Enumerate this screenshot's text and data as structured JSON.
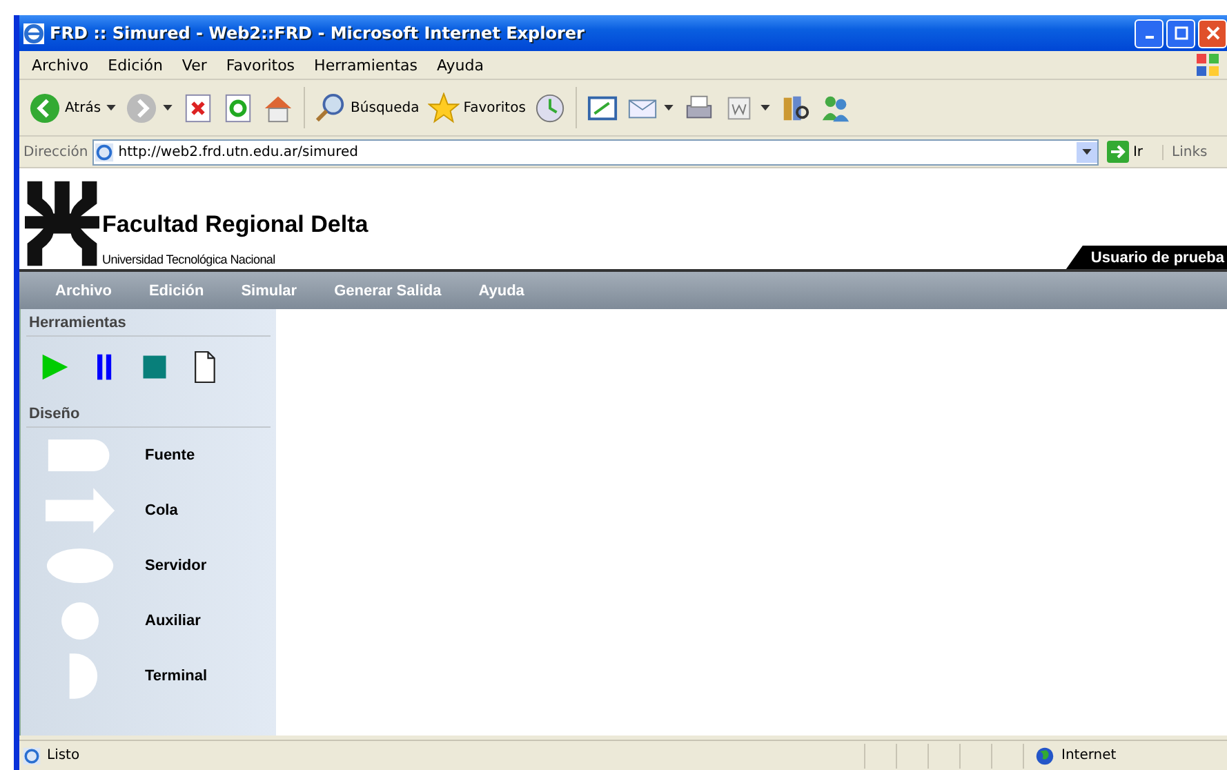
{
  "window": {
    "title": "FRD :: Simured - Web2::FRD - Microsoft Internet Explorer"
  },
  "menu_bar": [
    "Archivo",
    "Edición",
    "Ver",
    "Favoritos",
    "Herramientas",
    "Ayuda"
  ],
  "toolbar": [
    [
      {
        "kind": "back",
        "label": "Atrás",
        "dropdown": true
      },
      {
        "kind": "forward",
        "dropdown": true
      },
      {
        "kind": "stop"
      },
      {
        "kind": "refresh"
      },
      {
        "kind": "home"
      }
    ],
    [
      {
        "kind": "search",
        "label": "Búsqueda"
      },
      {
        "kind": "favorites",
        "label": "Favoritos"
      },
      {
        "kind": "history"
      }
    ],
    [
      {
        "kind": "media"
      },
      {
        "kind": "mail",
        "dropdown": true
      },
      {
        "kind": "print"
      },
      {
        "kind": "edit",
        "dropdown": true
      },
      {
        "kind": "research"
      },
      {
        "kind": "messenger"
      }
    ]
  ],
  "address_bar": {
    "label": "Dirección",
    "url": "http://web2.frd.utn.edu.ar/simured",
    "go": "Ir",
    "links": "Links"
  },
  "site_header": {
    "title": "Facultad Regional Delta",
    "subtitle": "Universidad Tecnológica Nacional",
    "user": "Usuario de prueba"
  },
  "site_menu": [
    "Archivo",
    "Edición",
    "Simular",
    "Generar Salida",
    "Ayuda"
  ],
  "sidebar": {
    "tools_title": "Herramientas",
    "tools": [
      {
        "kind": "play"
      },
      {
        "kind": "pause"
      },
      {
        "kind": "stop"
      },
      {
        "kind": "new"
      }
    ],
    "design_title": "Diseño",
    "shapes": [
      {
        "kind": "fuente",
        "label": "Fuente"
      },
      {
        "kind": "cola",
        "label": "Cola"
      },
      {
        "kind": "servidor",
        "label": "Servidor"
      },
      {
        "kind": "auxiliar",
        "label": "Auxiliar"
      },
      {
        "kind": "terminal",
        "label": "Terminal"
      }
    ]
  },
  "status_bar": {
    "text": "Listo",
    "zone": "Internet"
  }
}
